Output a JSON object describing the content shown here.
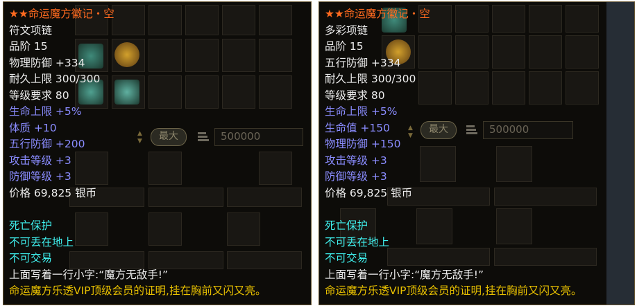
{
  "colors": {
    "title": "#ff6a1f",
    "basic_stat": "#ececec",
    "bonus_stat": "#8a8cff",
    "property": "#3ff0ee",
    "flavor": "#e8c000"
  },
  "left": {
    "title": "★★命运魔方徽记・空",
    "item_type": "符文项链",
    "grade": "品阶 15",
    "base_stat": "物理防御 +334",
    "durability": "耐久上限 300/300",
    "level_req": "等级要求 80",
    "bonus_stats": [
      "生命上限 +5%",
      "体质 +10",
      "五行防御 +200",
      "攻击等级 +3",
      "防御等级 +3"
    ],
    "price": "价格 69,825 银币",
    "properties": [
      "死亡保护",
      "不可丢在地上",
      "不可交易"
    ],
    "desc_line1": "上面写着一行小字:“魔方无敌手!”",
    "desc_line2": "命运魔方乐透VIP顶级会员的证明,挂在胸前又闪又亮。",
    "max_button": "最大",
    "amount_value": "500000"
  },
  "right": {
    "title": "★★命运魔方徽记・空",
    "item_type": "多彩项链",
    "grade": "品阶 15",
    "base_stat": "五行防御 +334",
    "durability": "耐久上限 300/300",
    "level_req": "等级要求 80",
    "bonus_stats": [
      "生命上限 +5%",
      "生命值 +150",
      "物理防御 +150",
      "攻击等级 +3",
      "防御等级 +3"
    ],
    "price": "价格 69,825 银币",
    "properties": [
      "死亡保护",
      "不可丢在地上",
      "不可交易"
    ],
    "desc_line1": "上面写着一行小字:“魔方无敌手!”",
    "desc_line2": "命运魔方乐透VIP顶级会员的证明,挂在胸前又闪又亮。",
    "max_button": "最大",
    "amount_value": "500000"
  }
}
